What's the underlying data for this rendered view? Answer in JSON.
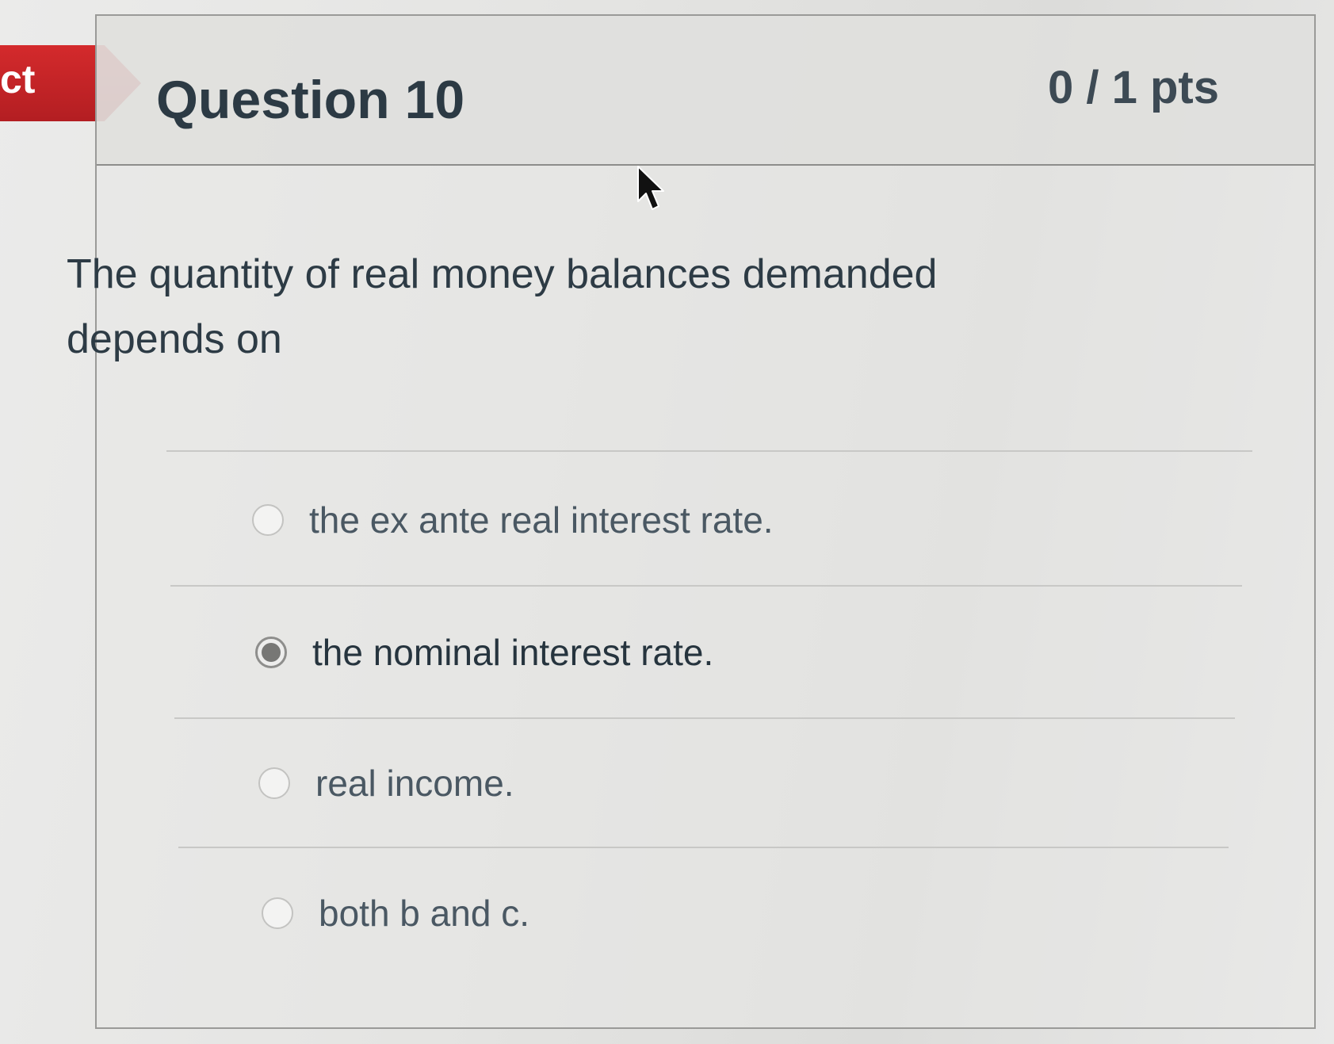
{
  "flag": {
    "text": "ct",
    "color": "#c4262a"
  },
  "question": {
    "title": "Question 10",
    "points": "0 / 1 pts",
    "text": "The quantity of real money balances demanded depends on"
  },
  "answers": [
    {
      "label": "the ex ante real interest rate.",
      "selected": false
    },
    {
      "label": "the nominal interest rate.",
      "selected": true
    },
    {
      "label": "real income.",
      "selected": false
    },
    {
      "label": "both b and c.",
      "selected": false
    }
  ],
  "cursor": {
    "icon": "arrow-pointer-icon"
  }
}
